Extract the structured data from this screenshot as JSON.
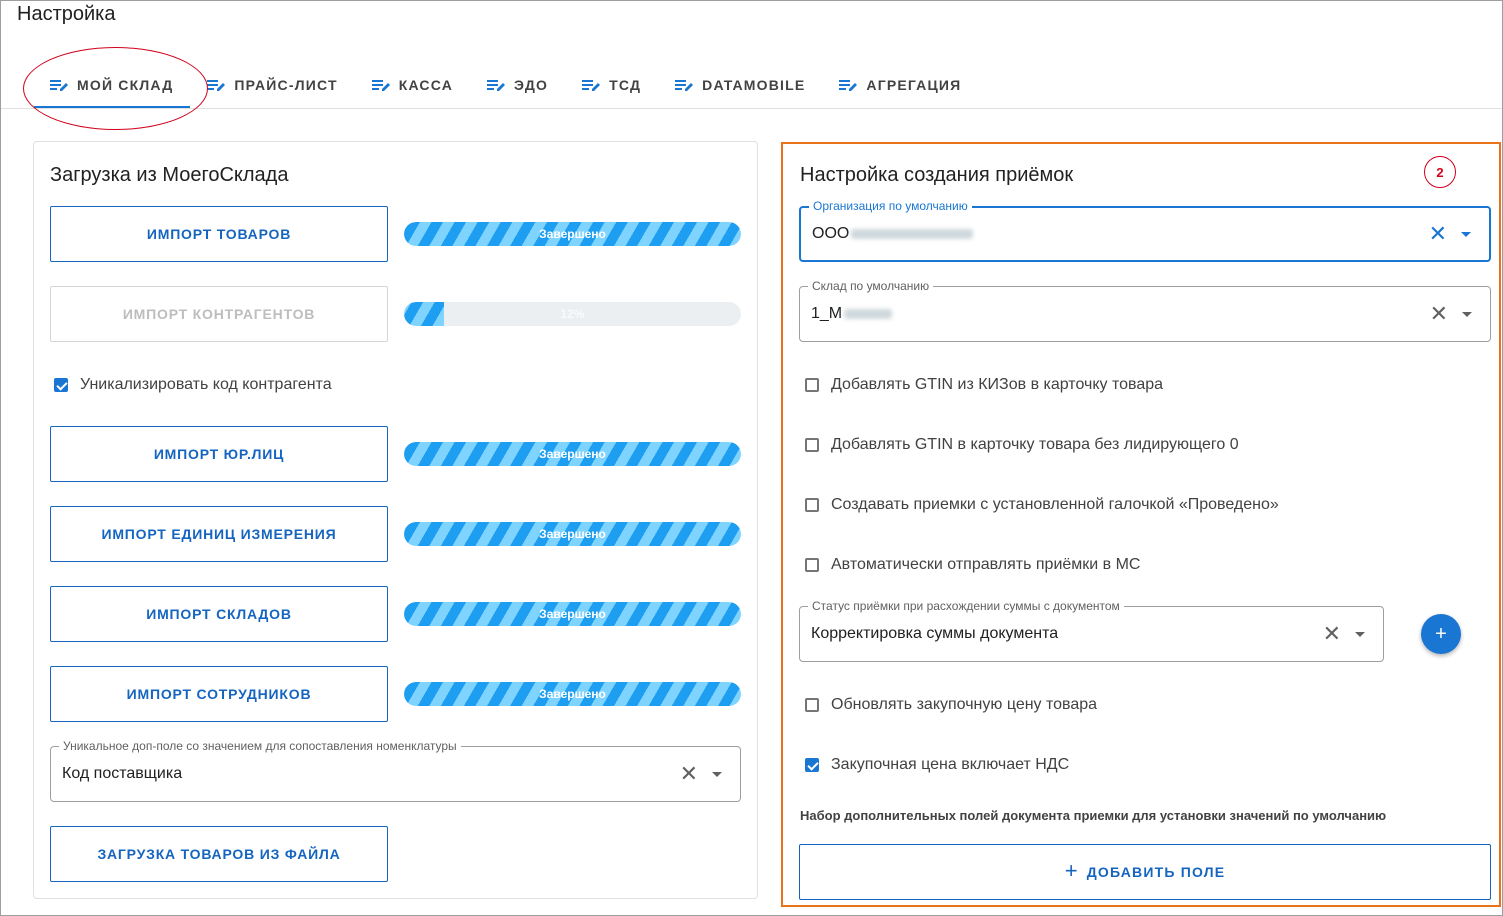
{
  "page": {
    "title": "Настройка"
  },
  "tabs": [
    {
      "label": "МОЙ СКЛАД",
      "active": true
    },
    {
      "label": "ПРАЙС-ЛИСТ"
    },
    {
      "label": "КАССА"
    },
    {
      "label": "ЭДО"
    },
    {
      "label": "ТСД"
    },
    {
      "label": "DATAMOBILE"
    },
    {
      "label": "АГРЕГАЦИЯ"
    }
  ],
  "left": {
    "title": "Загрузка из МоегоСклада",
    "import_goods": {
      "label": "ИМПОРТ ТОВАРОВ",
      "status": "Завершено",
      "progress": 100
    },
    "import_contractors": {
      "label": "ИМПОРТ КОНТРАГЕНТОВ",
      "status": "12%",
      "progress": 12,
      "disabled": true
    },
    "uniq_checkbox": {
      "label": "Уникализировать код контрагента",
      "checked": true
    },
    "import_legal": {
      "label": "ИМПОРТ ЮР.ЛИЦ",
      "status": "Завершено",
      "progress": 100
    },
    "import_units": {
      "label": "ИМПОРТ ЕДИНИЦ ИЗМЕРЕНИЯ",
      "status": "Завершено",
      "progress": 100
    },
    "import_warehouses": {
      "label": "ИМПОРТ СКЛАДОВ",
      "status": "Завершено",
      "progress": 100
    },
    "import_employees": {
      "label": "ИМПОРТ СОТРУДНИКОВ",
      "status": "Завершено",
      "progress": 100
    },
    "match_field": {
      "legend": "Уникальное доп-поле со значением для сопоставления номенклатуры",
      "value": "Код поставщика"
    },
    "load_file": {
      "label": "ЗАГРУЗКА ТОВАРОВ ИЗ ФАЙЛА"
    }
  },
  "right": {
    "title": "Настройка создания приёмок",
    "badge": "2",
    "org": {
      "legend": "Организация по умолчанию",
      "value": "ООО"
    },
    "warehouse": {
      "legend": "Склад по умолчанию",
      "value": "1_М"
    },
    "cb_gtin_kiz": {
      "label": "Добавлять GTIN из КИЗов в карточку товара",
      "checked": false
    },
    "cb_gtin_zero": {
      "label": "Добавлять GTIN в карточку товара без лидирующего 0",
      "checked": false
    },
    "cb_posted": {
      "label": "Создавать приемки с установленной галочкой «Проведено»",
      "checked": false
    },
    "cb_auto_send": {
      "label": "Автоматически отправлять приёмки в МС",
      "checked": false
    },
    "status_select": {
      "legend": "Статус приёмки при расхождении суммы с документом",
      "value": "Корректировка суммы документа"
    },
    "fab_label": "+",
    "cb_update_price": {
      "label": "Обновлять закупочную цену товара",
      "checked": false
    },
    "cb_vat": {
      "label": "Закупочная цена включает НДС",
      "checked": true
    },
    "hint": "Набор дополнительных полей документа приемки для установки значений по умолчанию",
    "add_field": {
      "plus": "+",
      "label": "ДОБАВИТЬ ПОЛЕ"
    }
  },
  "colors": {
    "accent": "#1976d2",
    "highlight": "#e8731a",
    "annotation": "#d0021b"
  }
}
